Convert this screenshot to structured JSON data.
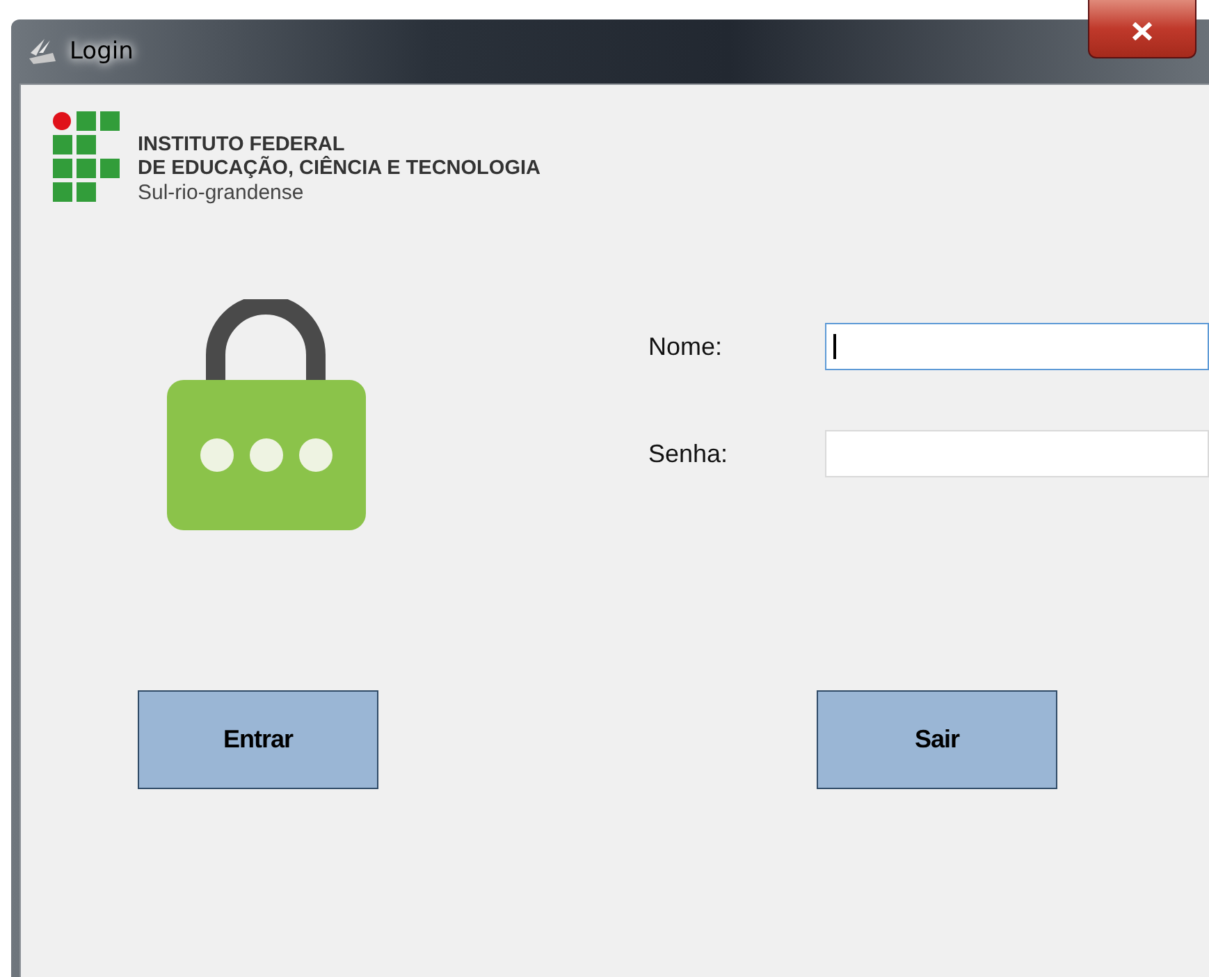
{
  "window": {
    "title": "Login"
  },
  "logo": {
    "lines": [
      "INSTITUTO FEDERAL",
      "DE EDUCAÇÃO, CIÊNCIA E TECNOLOGIA"
    ],
    "subtitle": "Sul-rio-grandense"
  },
  "fields": [
    {
      "label": "Nome:",
      "focused": true
    },
    {
      "label": "Senha:",
      "focused": false
    }
  ],
  "buttons": [
    "Entrar",
    "Sair"
  ]
}
